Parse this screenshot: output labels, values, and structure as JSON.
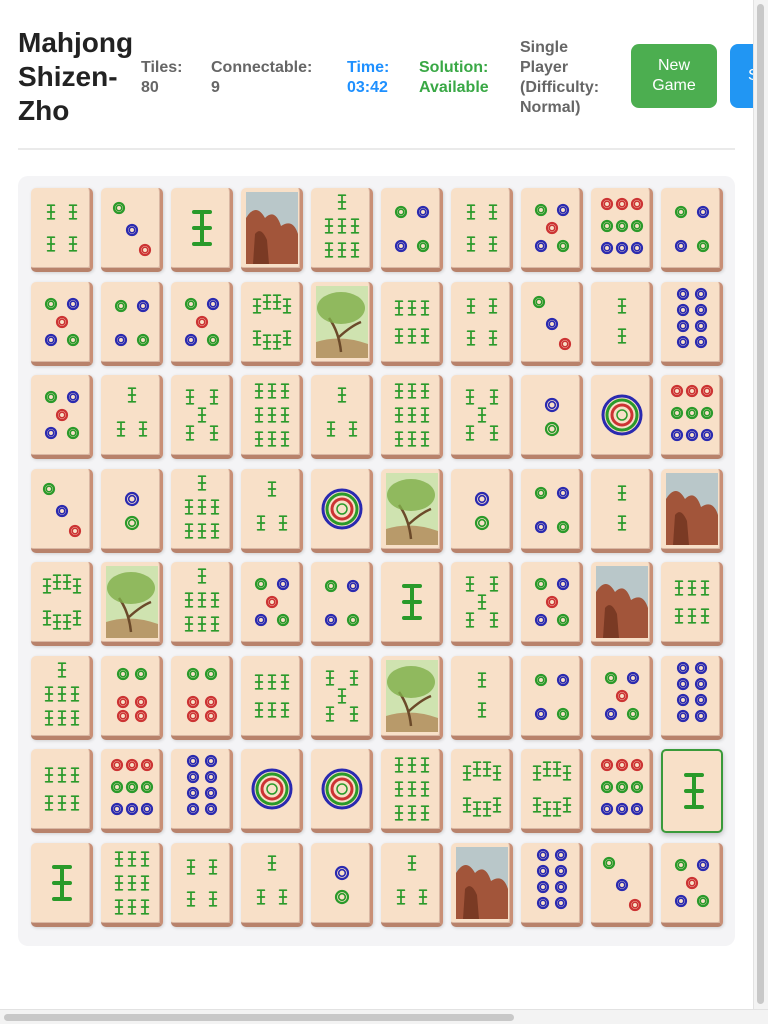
{
  "header": {
    "title": "Mahjong Shizen-Zho",
    "tiles_label": "Tiles:",
    "tiles_value": "80",
    "connectable_label": "Connectable:",
    "connectable_value": "9",
    "time_label": "Time:",
    "time_value": "03:42",
    "solution_label": "Solution:",
    "solution_value": "Available",
    "mode_text": "Single Player (Difficulty: Normal)",
    "new_game_label": "New Game",
    "second_button_label": "S"
  },
  "board": {
    "columns": 10,
    "rows": 8,
    "tiles": [
      [
        "bam4",
        "dot3",
        "bam1",
        "scene-rock",
        "bam7",
        "dot4",
        "bam4",
        "dot5",
        "dot9",
        "dot4"
      ],
      [
        "dot5",
        "dot4",
        "dot5",
        "bam8",
        "scene-tree",
        "bam6",
        "bam4",
        "dot3",
        "bam2",
        "dot8"
      ],
      [
        "dot5",
        "bam3",
        "bam5",
        "bam9",
        "bam3",
        "bam9",
        "bam5",
        "dot2",
        "dot1",
        "dot9"
      ],
      [
        "dot3",
        "dot2",
        "bam7",
        "bam3",
        "dot1",
        "scene-tree",
        "dot2",
        "dot4",
        "bam2",
        "scene-rock"
      ],
      [
        "bam8",
        "scene-tree",
        "bam7",
        "dot5",
        "dot4",
        "bam1",
        "bam5",
        "dot5",
        "scene-rock",
        "bam6"
      ],
      [
        "bam7",
        "dot6",
        "dot6",
        "bam6",
        "bam5",
        "scene-tree",
        "bam2",
        "dot4",
        "dot5",
        "dot8"
      ],
      [
        "bam6",
        "dot9",
        "dot8",
        "dot1",
        "dot1",
        "bam9",
        "bam8",
        "bam8",
        "dot9",
        "bam1"
      ],
      [
        "bam1",
        "bam9",
        "bam4",
        "bam3",
        "dot2",
        "bam3",
        "scene-rock",
        "dot8",
        "dot3",
        "dot5"
      ]
    ],
    "selected_tile": [
      6,
      9
    ]
  },
  "colors": {
    "accent_blue": "#2196f3",
    "accent_green": "#4cae50",
    "time_color": "#1e90ff",
    "solution_color": "#39a845"
  }
}
